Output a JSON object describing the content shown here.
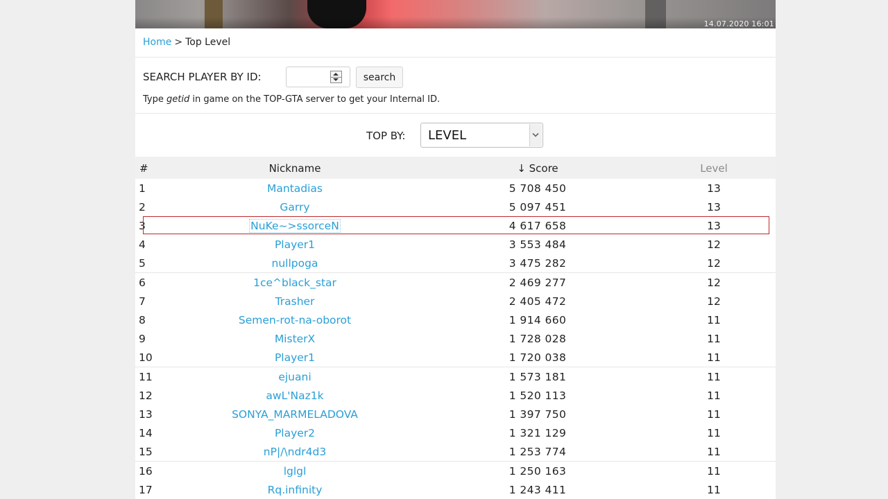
{
  "banner": {
    "date": "14.07.2020 16:01"
  },
  "breadcrumb": {
    "home": "Home",
    "separator": ">",
    "current": "Top Level"
  },
  "search": {
    "label": "SEARCH PLAYER BY ID:",
    "input_value": "",
    "button_label": "search",
    "hint_prefix": "Type ",
    "hint_command": "getid",
    "hint_suffix": " in game on the TOP-GTA server to get your Internal ID."
  },
  "top_by": {
    "label": "TOP BY:",
    "selected": "LEVEL"
  },
  "table": {
    "headers": {
      "rank": "#",
      "nickname": "Nickname",
      "score": "↓ Score",
      "level": "Level"
    },
    "highlighted_rank": "3",
    "rows": [
      {
        "rank": "1",
        "nickname": "Mantadias",
        "score": "5 708 450",
        "level": "13"
      },
      {
        "rank": "2",
        "nickname": "Garry",
        "score": "5 097 451",
        "level": "13"
      },
      {
        "rank": "3",
        "nickname": "NuKe~>ssorceN",
        "score": "4 617 658",
        "level": "13"
      },
      {
        "rank": "4",
        "nickname": "Player1",
        "score": "3 553 484",
        "level": "12"
      },
      {
        "rank": "5",
        "nickname": "nullpoga",
        "score": "3 475 282",
        "level": "12"
      },
      {
        "rank": "6",
        "nickname": "1ce^black_star",
        "score": "2 469 277",
        "level": "12"
      },
      {
        "rank": "7",
        "nickname": "Trasher",
        "score": "2 405 472",
        "level": "12"
      },
      {
        "rank": "8",
        "nickname": "Semen-rot-na-oborot",
        "score": "1 914 660",
        "level": "11"
      },
      {
        "rank": "9",
        "nickname": "MisterX",
        "score": "1 728 028",
        "level": "11"
      },
      {
        "rank": "10",
        "nickname": "Player1",
        "score": "1 720 038",
        "level": "11"
      },
      {
        "rank": "11",
        "nickname": "ejuani",
        "score": "1 573 181",
        "level": "11"
      },
      {
        "rank": "12",
        "nickname": "awL'Naz1k",
        "score": "1 520 113",
        "level": "11"
      },
      {
        "rank": "13",
        "nickname": "SONYA_MARMELADOVA",
        "score": "1 397 750",
        "level": "11"
      },
      {
        "rank": "14",
        "nickname": "Player2",
        "score": "1 321 129",
        "level": "11"
      },
      {
        "rank": "15",
        "nickname": "nP|/\\ndr4d3",
        "score": "1 253 774",
        "level": "11"
      },
      {
        "rank": "16",
        "nickname": "lglgl",
        "score": "1 250 163",
        "level": "11"
      },
      {
        "rank": "17",
        "nickname": "Rq.infinity",
        "score": "1 243 411",
        "level": "11"
      }
    ]
  }
}
